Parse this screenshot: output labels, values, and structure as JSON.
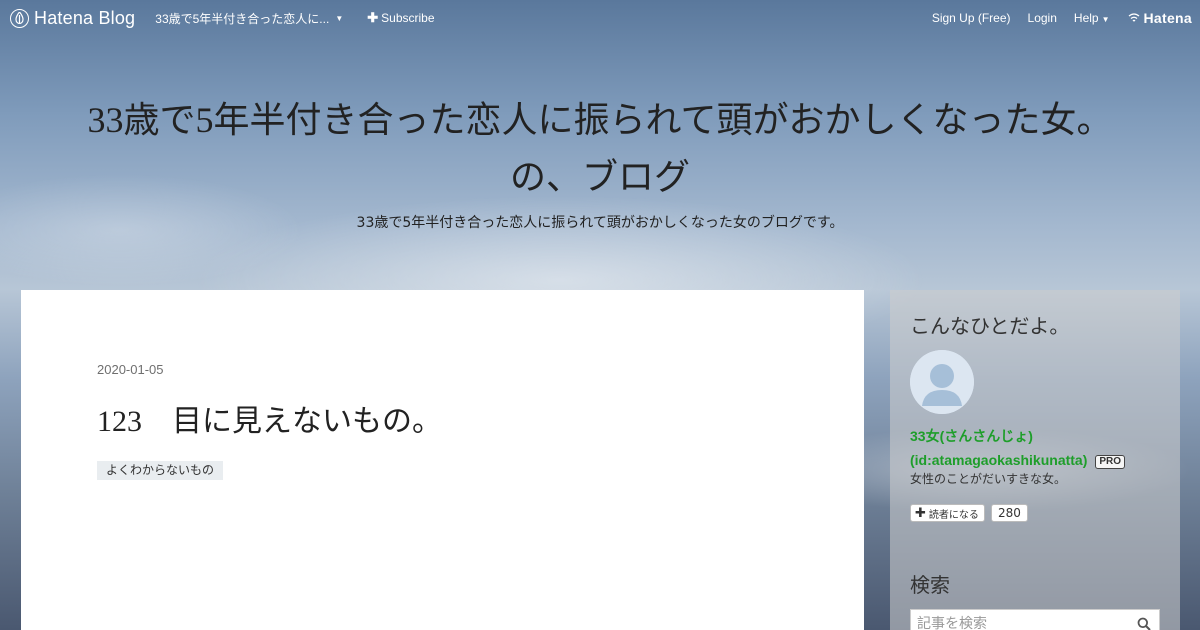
{
  "topbar": {
    "brand": "Hatena Blog",
    "blog_menu": "33歳で5年半付き合った恋人に...",
    "subscribe": "Subscribe",
    "signup": "Sign Up (Free)",
    "login": "Login",
    "help": "Help",
    "hatena": "Hatena"
  },
  "header": {
    "title_line1": "33歳で5年半付き合った恋人に振られて頭がおかしくなった女。",
    "title_line2": "の、ブログ",
    "description": "33歳で5年半付き合った恋人に振られて頭がおかしくなった女のブログです。"
  },
  "entry": {
    "date": "2020-01-05",
    "title": "123　目に見えないもの。",
    "category": "よくわからないもの"
  },
  "sidebar": {
    "about_title": "こんなひとだよ。",
    "author_name": "33女(さんさんじょ)",
    "author_id": "(id:atamagaokashikunatta)",
    "pro_badge": "PRO",
    "author_desc": "女性のことがだいすきな女。",
    "reader_button": "読者になる",
    "reader_count": "280",
    "search_title": "検索",
    "search_placeholder": "記事を検索"
  },
  "colors": {
    "author_link": "#1e9e2a",
    "category_bg": "#e9edf0"
  },
  "icons": [
    "hatena-blog-icon",
    "caret-down-icon",
    "plus-icon",
    "hatena-logo-icon",
    "avatar-icon",
    "search-icon"
  ]
}
